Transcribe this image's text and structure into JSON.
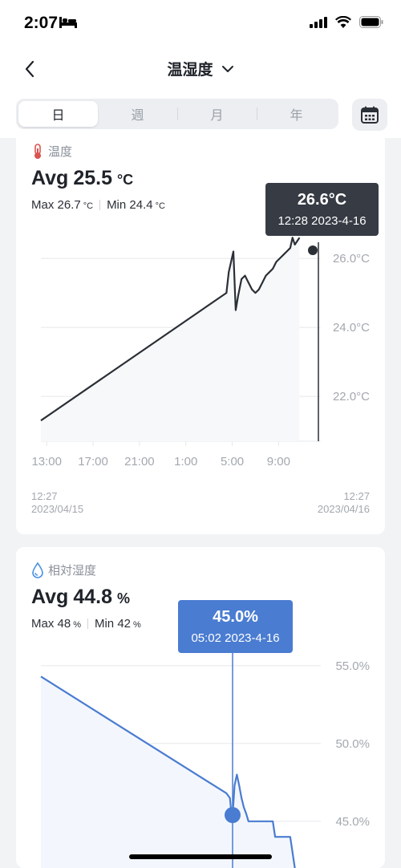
{
  "status_bar": {
    "time": "2:07",
    "icons": [
      "bed-icon",
      "signal-icon",
      "wifi-icon",
      "battery-icon"
    ]
  },
  "nav": {
    "title": "温湿度",
    "icons": [
      "back-chevron-icon",
      "dropdown-chevron-icon"
    ]
  },
  "period_tabs": [
    {
      "label": "日",
      "active": true
    },
    {
      "label": "週",
      "active": false
    },
    {
      "label": "月",
      "active": false
    },
    {
      "label": "年",
      "active": false
    }
  ],
  "temperature": {
    "title": "温度",
    "avg_label": "Avg",
    "avg_value": "25.5",
    "unit": "°C",
    "max_label": "Max",
    "max_value": "26.7",
    "min_label": "Min",
    "min_value": "24.4",
    "tooltip_value": "26.6°C",
    "tooltip_time": "12:28 2023-4-16",
    "range_start_time": "12:27",
    "range_start_date": "2023/04/15",
    "range_end_time": "12:27",
    "range_end_date": "2023/04/16",
    "color": "#2b2f36"
  },
  "humidity": {
    "title": "相対湿度",
    "avg_label": "Avg",
    "avg_value": "44.8",
    "unit": "%",
    "max_label": "Max",
    "max_value": "48",
    "min_label": "Min",
    "min_value": "42",
    "tooltip_value": "45.0%",
    "tooltip_time": "05:02 2023-4-16",
    "color": "#4a7cd1"
  },
  "chart_data": [
    {
      "type": "line",
      "title": "温度",
      "x_ticks": [
        "13:00",
        "17:00",
        "21:00",
        "1:00",
        "5:00",
        "9:00"
      ],
      "y_ticks": [
        "26.0°C",
        "24.0°C",
        "22.0°C"
      ],
      "ylim": [
        20.7,
        26.7
      ],
      "x_hours": [
        0,
        16,
        16.2,
        16.4,
        16.6,
        16.8,
        17.0,
        17.3,
        17.6,
        17.9,
        18.2,
        18.5,
        18.8,
        19.1,
        19.4,
        19.7,
        20.0,
        20.3,
        20.6,
        20.9,
        21.2,
        21.5,
        21.7,
        21.9,
        22.1,
        22.3
      ],
      "values": [
        21.3,
        25.0,
        25.6,
        25.9,
        26.2,
        24.5,
        24.9,
        25.4,
        25.5,
        25.3,
        25.1,
        25.0,
        25.1,
        25.3,
        25.5,
        25.6,
        25.7,
        25.9,
        26.0,
        26.1,
        26.2,
        26.3,
        26.6,
        26.4,
        26.5,
        26.6
      ],
      "grid": true,
      "cursor_time": "12:28"
    },
    {
      "type": "line",
      "title": "相対湿度",
      "x_ticks": [],
      "y_ticks": [
        "55.0%",
        "50.0%",
        "45.0%"
      ],
      "ylim": [
        42,
        55.4
      ],
      "x_hours": [
        0,
        16,
        16.3,
        16.5,
        16.7,
        16.9,
        17.1,
        17.3,
        17.5,
        17.7,
        17.9,
        18.2,
        20.0,
        20.2,
        21.5,
        21.7,
        21.9
      ],
      "values": [
        54.3,
        46.8,
        46.5,
        45.0,
        47.3,
        48.0,
        47.3,
        46.5,
        45.9,
        45.5,
        45.0,
        45.0,
        45.0,
        44.0,
        44.0,
        43.0,
        42.0
      ],
      "grid": true,
      "cursor_value": 45.0
    }
  ]
}
